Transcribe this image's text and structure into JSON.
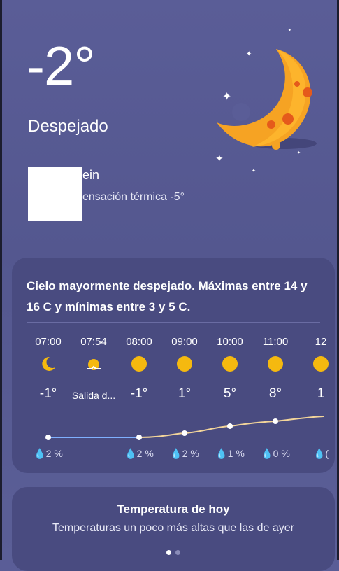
{
  "current": {
    "temperature": "-2°",
    "condition": "Despejado",
    "location": "ein",
    "feels_like": "ensación térmica -5°"
  },
  "forecast": {
    "summary": "Cielo mayormente despejado. Máximas entre 14 y 16 C y mínimas entre 3 y 5 C.",
    "hours": [
      {
        "time": "07:00",
        "icon": "moon-icon",
        "temp": "-1°",
        "precip": "2 %"
      },
      {
        "time": "07:54",
        "icon": "sunrise-icon",
        "temp": "Salida d...",
        "precip": ""
      },
      {
        "time": "08:00",
        "icon": "sun-icon",
        "temp": "-1°",
        "precip": "2 %"
      },
      {
        "time": "09:00",
        "icon": "sun-icon",
        "temp": "1°",
        "precip": "2 %"
      },
      {
        "time": "10:00",
        "icon": "sun-icon",
        "temp": "5°",
        "precip": "1 %"
      },
      {
        "time": "11:00",
        "icon": "sun-icon",
        "temp": "8°",
        "precip": "0 %"
      },
      {
        "time": "12",
        "icon": "sun-icon",
        "temp": "1",
        "precip": "("
      }
    ]
  },
  "today_card": {
    "title": "Temperatura de hoy",
    "text": "Temperaturas un poco más altas que las de ayer"
  },
  "colors": {
    "background": "#5a5d97",
    "card": "#494b80",
    "sun": "#f5b90f",
    "cold_line": "#7fb0ff",
    "warm_line": "#f3d59a"
  }
}
